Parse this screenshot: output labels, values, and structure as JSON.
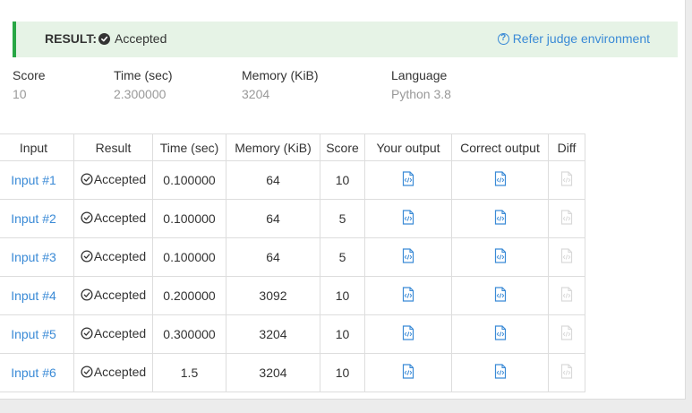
{
  "result": {
    "label": "RESULT:",
    "status": "Accepted",
    "status_icon": "check-circle-icon",
    "refer_link": "Refer judge environment",
    "refer_icon": "question-circle-icon",
    "accent_color": "#28a745",
    "link_color": "#3a8ad6"
  },
  "summary": {
    "score": {
      "label": "Score",
      "value": "10"
    },
    "time": {
      "label": "Time (sec)",
      "value": "2.300000"
    },
    "memory": {
      "label": "Memory (KiB)",
      "value": "3204"
    },
    "language": {
      "label": "Language",
      "value": "Python 3.8"
    }
  },
  "table": {
    "headers": [
      "Input",
      "Result",
      "Time (sec)",
      "Memory (KiB)",
      "Score",
      "Your output",
      "Correct output",
      "Diff"
    ],
    "rows": [
      {
        "input": "Input #1",
        "result": "Accepted",
        "time": "0.100000",
        "memory": "64",
        "score": "10"
      },
      {
        "input": "Input #2",
        "result": "Accepted",
        "time": "0.100000",
        "memory": "64",
        "score": "5"
      },
      {
        "input": "Input #3",
        "result": "Accepted",
        "time": "0.100000",
        "memory": "64",
        "score": "5"
      },
      {
        "input": "Input #4",
        "result": "Accepted",
        "time": "0.200000",
        "memory": "3092",
        "score": "10"
      },
      {
        "input": "Input #5",
        "result": "Accepted",
        "time": "0.300000",
        "memory": "3204",
        "score": "10"
      },
      {
        "input": "Input #6",
        "result": "Accepted",
        "time": "1.5",
        "memory": "3204",
        "score": "10"
      }
    ],
    "output_icon": "code-file-icon",
    "diff_icon": "code-file-icon-disabled"
  }
}
